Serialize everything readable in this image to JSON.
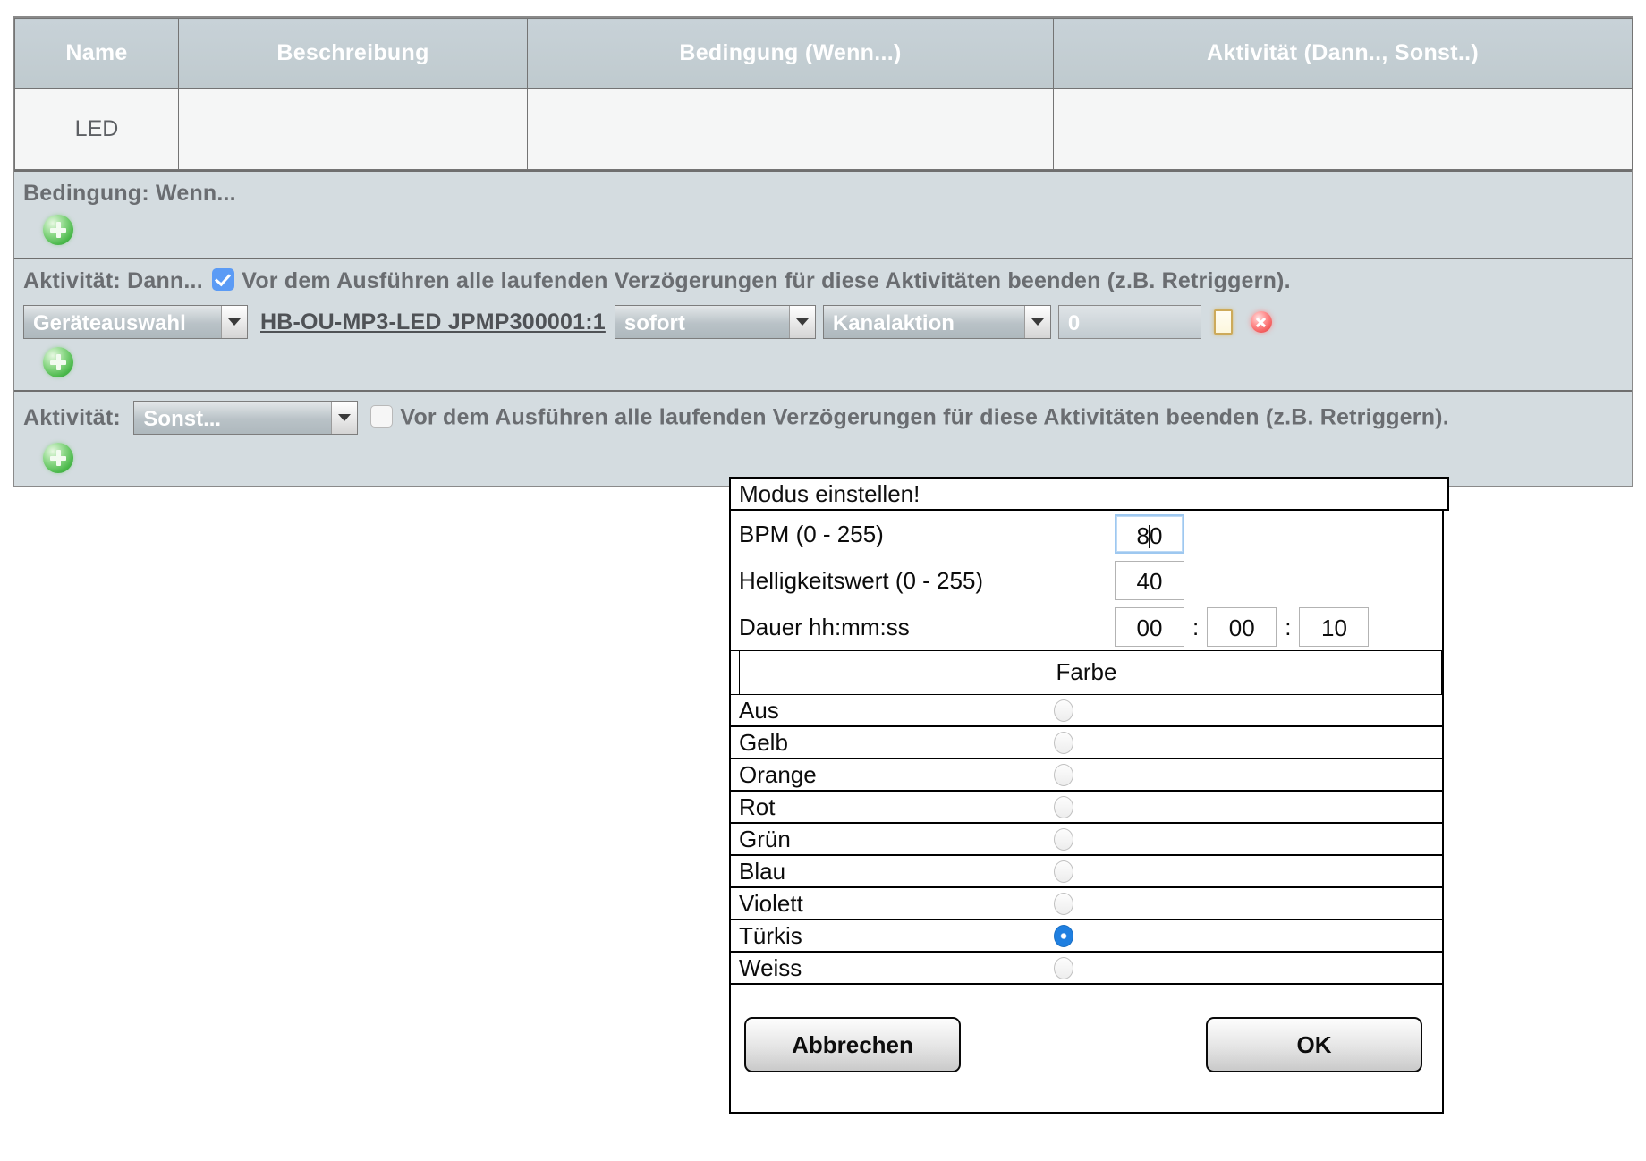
{
  "table": {
    "columns": [
      "Name",
      "Beschreibung",
      "Bedingung (Wenn...)",
      "Aktivität (Dann.., Sonst..)"
    ],
    "rows": [
      {
        "name": "LED",
        "beschreibung": "",
        "bedingung": "",
        "aktivitaet": ""
      }
    ]
  },
  "condition_section": {
    "label": "Bedingung: Wenn...",
    "add_icon": "add-circle-icon"
  },
  "then_section": {
    "label": "Aktivität: Dann...",
    "checkbox_checked": true,
    "checkbox_text": "Vor dem Ausführen alle laufenden Verzögerungen für diese Aktivitäten beenden (z.B. Retriggern).",
    "device_select": "Geräteauswahl",
    "device_name": "HB-OU-MP3-LED JPMP300001:1",
    "timing_select": "sofort",
    "action_select": "Kanalaktion",
    "value": "0",
    "copy_icon": "copy-icon",
    "delete_icon": "delete-icon",
    "add_icon": "add-circle-icon"
  },
  "else_section": {
    "label": "Aktivität:",
    "mode_select": "Sonst...",
    "checkbox_checked": false,
    "checkbox_text": "Vor dem Ausführen alle laufenden Verzögerungen für diese Aktivitäten beenden (z.B. Retriggern).",
    "add_icon": "add-circle-icon"
  },
  "dialog": {
    "title": "Modus einstellen!",
    "fields": [
      {
        "label": "BPM (0 - 255)",
        "value": "80"
      },
      {
        "label": "Helligkeitswert (0 - 255)",
        "value": "40"
      }
    ],
    "duration": {
      "label": "Dauer hh:mm:ss",
      "hours": "00",
      "minutes": "00",
      "seconds": "10",
      "separator": ":"
    },
    "color_header": "Farbe",
    "colors": [
      {
        "label": "Aus",
        "selected": false
      },
      {
        "label": "Gelb",
        "selected": false
      },
      {
        "label": "Orange",
        "selected": false
      },
      {
        "label": "Rot",
        "selected": false
      },
      {
        "label": "Grün",
        "selected": false
      },
      {
        "label": "Blau",
        "selected": false
      },
      {
        "label": "Violett",
        "selected": false
      },
      {
        "label": "Türkis",
        "selected": true
      },
      {
        "label": "Weiss",
        "selected": false
      }
    ],
    "cancel_label": "Abbrechen",
    "ok_label": "OK"
  },
  "colors": {
    "header_bg": "#c3ced4",
    "panel_bg": "#d4dce0",
    "row_bg": "#f5f6f6",
    "accent_blue": "#2f80e8",
    "checkbox_blue": "#5b9bf5",
    "text_gray": "#6a6d71"
  }
}
